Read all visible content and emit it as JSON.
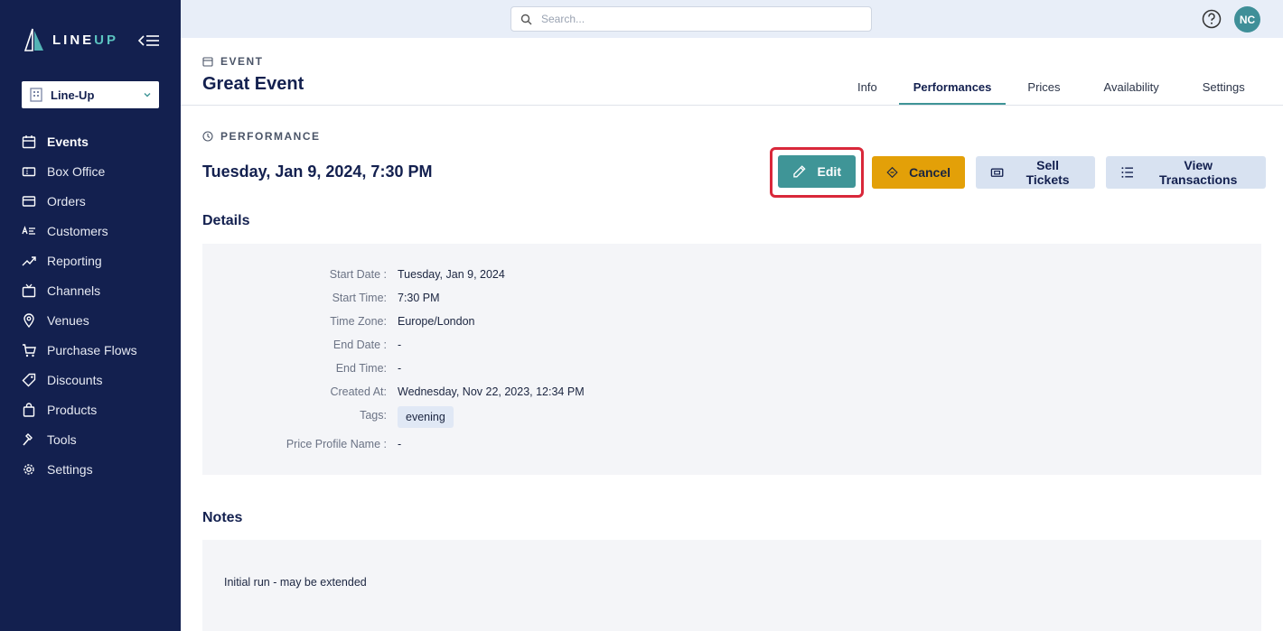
{
  "brand": {
    "line": "LINE",
    "up": "UP"
  },
  "org_select": {
    "label": "Line-Up"
  },
  "nav": [
    {
      "label": "Events",
      "icon": "calendar-icon",
      "active": true
    },
    {
      "label": "Box Office",
      "icon": "ticket-icon"
    },
    {
      "label": "Orders",
      "icon": "card-icon"
    },
    {
      "label": "Customers",
      "icon": "customers-icon"
    },
    {
      "label": "Reporting",
      "icon": "trend-icon"
    },
    {
      "label": "Channels",
      "icon": "tv-icon"
    },
    {
      "label": "Venues",
      "icon": "map-pin-icon"
    },
    {
      "label": "Purchase Flows",
      "icon": "cart-icon"
    },
    {
      "label": "Discounts",
      "icon": "tag-icon"
    },
    {
      "label": "Products",
      "icon": "bag-icon"
    },
    {
      "label": "Tools",
      "icon": "hammer-icon"
    },
    {
      "label": "Settings",
      "icon": "gear-icon"
    }
  ],
  "search": {
    "placeholder": "Search..."
  },
  "user": {
    "initials": "NC"
  },
  "event": {
    "label": "EVENT",
    "title": "Great Event"
  },
  "tabs": [
    {
      "label": "Info"
    },
    {
      "label": "Performances",
      "active": true
    },
    {
      "label": "Prices"
    },
    {
      "label": "Availability"
    },
    {
      "label": "Settings"
    }
  ],
  "performance": {
    "label": "PERFORMANCE",
    "title": "Tuesday, Jan 9, 2024, 7:30 PM"
  },
  "actions": {
    "edit": "Edit",
    "cancel": "Cancel",
    "sell": "Sell Tickets",
    "view": "View Transactions"
  },
  "details": {
    "title": "Details",
    "rows": [
      {
        "key": "Start Date :",
        "value": "Tuesday, Jan 9, 2024"
      },
      {
        "key": "Start Time:",
        "value": "7:30 PM"
      },
      {
        "key": "Time Zone:",
        "value": "Europe/London"
      },
      {
        "key": "End Date :",
        "value": "-"
      },
      {
        "key": "End Time:",
        "value": "-"
      },
      {
        "key": "Created At:",
        "value": "Wednesday, Nov 22, 2023, 12:34 PM"
      },
      {
        "key": "Tags:",
        "value": "evening"
      },
      {
        "key": "Price Profile Name :",
        "value": "-"
      }
    ]
  },
  "notes": {
    "title": "Notes",
    "text": "Initial run - may be extended"
  },
  "colors": {
    "sidebar": "#13204f",
    "accent": "#3f9597",
    "warning": "#e3a008",
    "highlight": "#d9283a"
  }
}
